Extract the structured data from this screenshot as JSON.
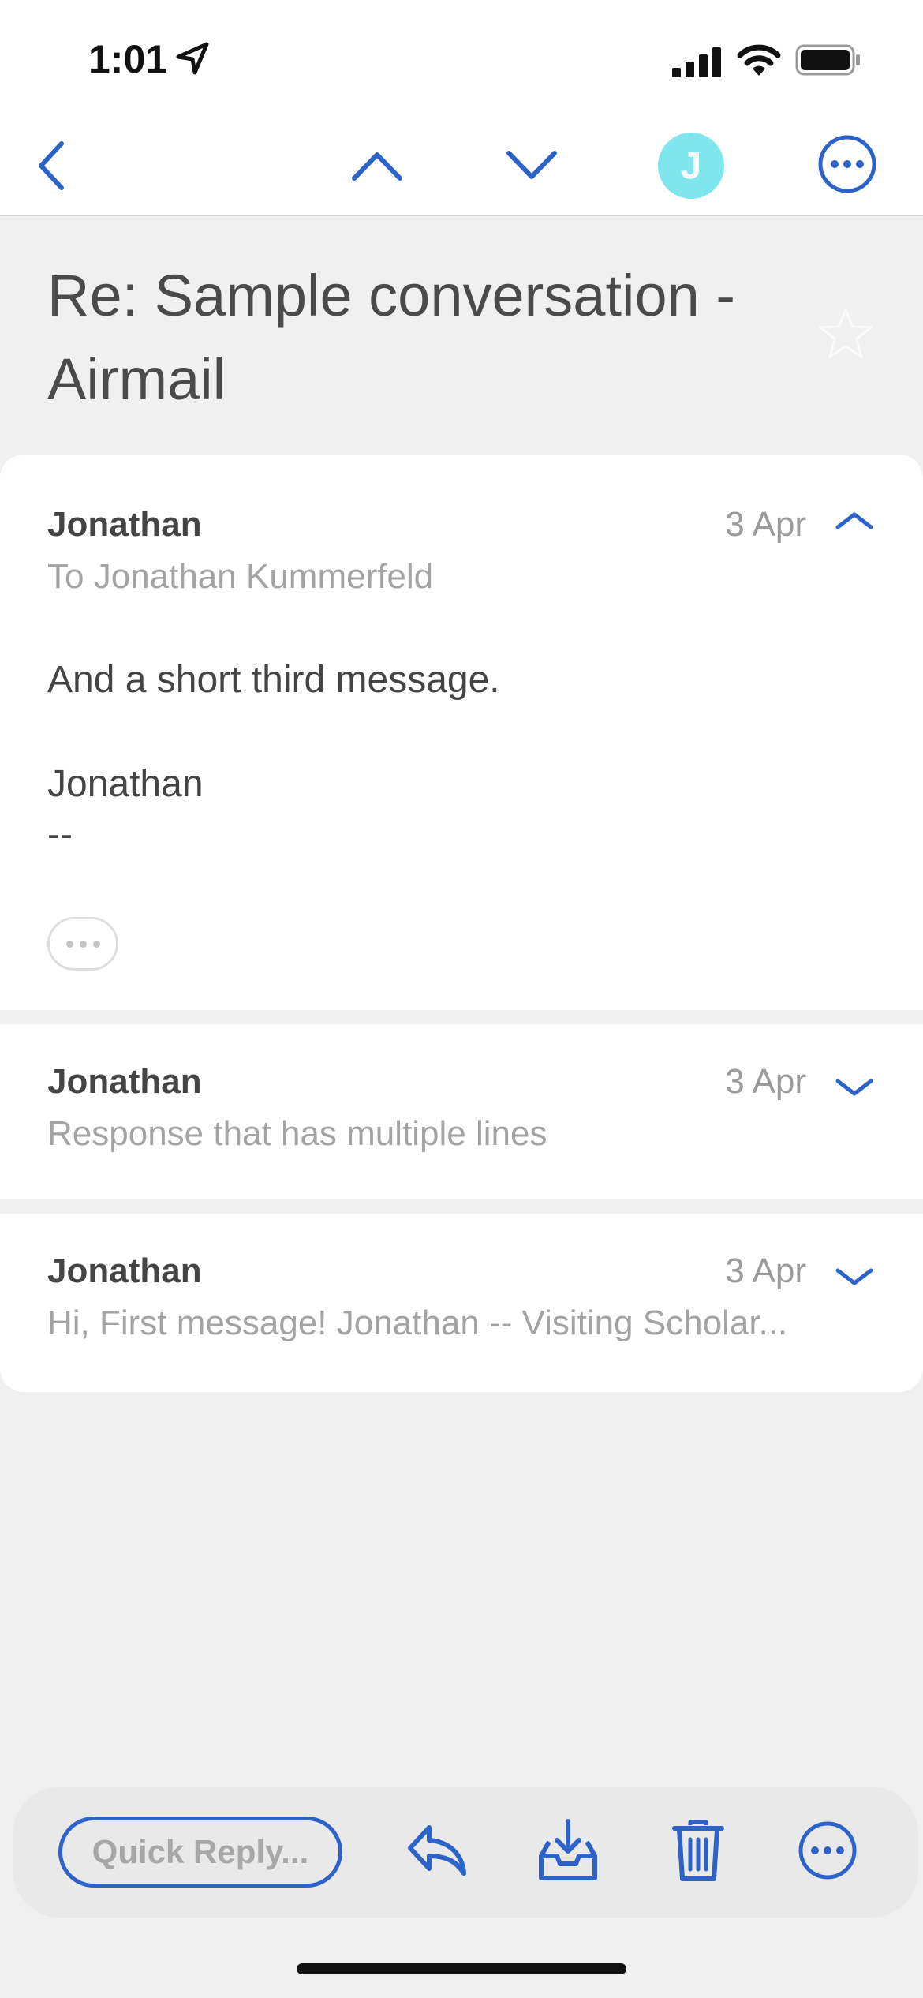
{
  "status_bar": {
    "time": "1:01"
  },
  "toolbar": {
    "back_icon": "chevron-left-icon",
    "prev_icon": "chevron-up-icon",
    "next_icon": "chevron-down-icon",
    "avatar_letter": "J",
    "more_icon": "ellipsis-circle-icon",
    "accent_color": "#2d63c8",
    "avatar_color": "#7ee6ec"
  },
  "thread": {
    "subject": "Re: Sample conversation - Airmail",
    "starred": false
  },
  "messages": [
    {
      "sender": "Jonathan",
      "date": "3 Apr",
      "expanded": true,
      "to": "To Jonathan Kummerfeld",
      "body": [
        "And a short third message.",
        "Jonathan",
        "--"
      ]
    },
    {
      "sender": "Jonathan",
      "date": "3 Apr",
      "expanded": false,
      "preview": "Response that has multiple lines"
    },
    {
      "sender": "Jonathan",
      "date": "3 Apr",
      "expanded": false,
      "preview": "Hi, First message! Jonathan -- Visiting Scholar..."
    }
  ],
  "bottom_bar": {
    "quick_reply_label": "Quick Reply...",
    "icons": [
      "reply-icon",
      "archive-icon",
      "trash-icon",
      "ellipsis-circle-icon"
    ]
  }
}
